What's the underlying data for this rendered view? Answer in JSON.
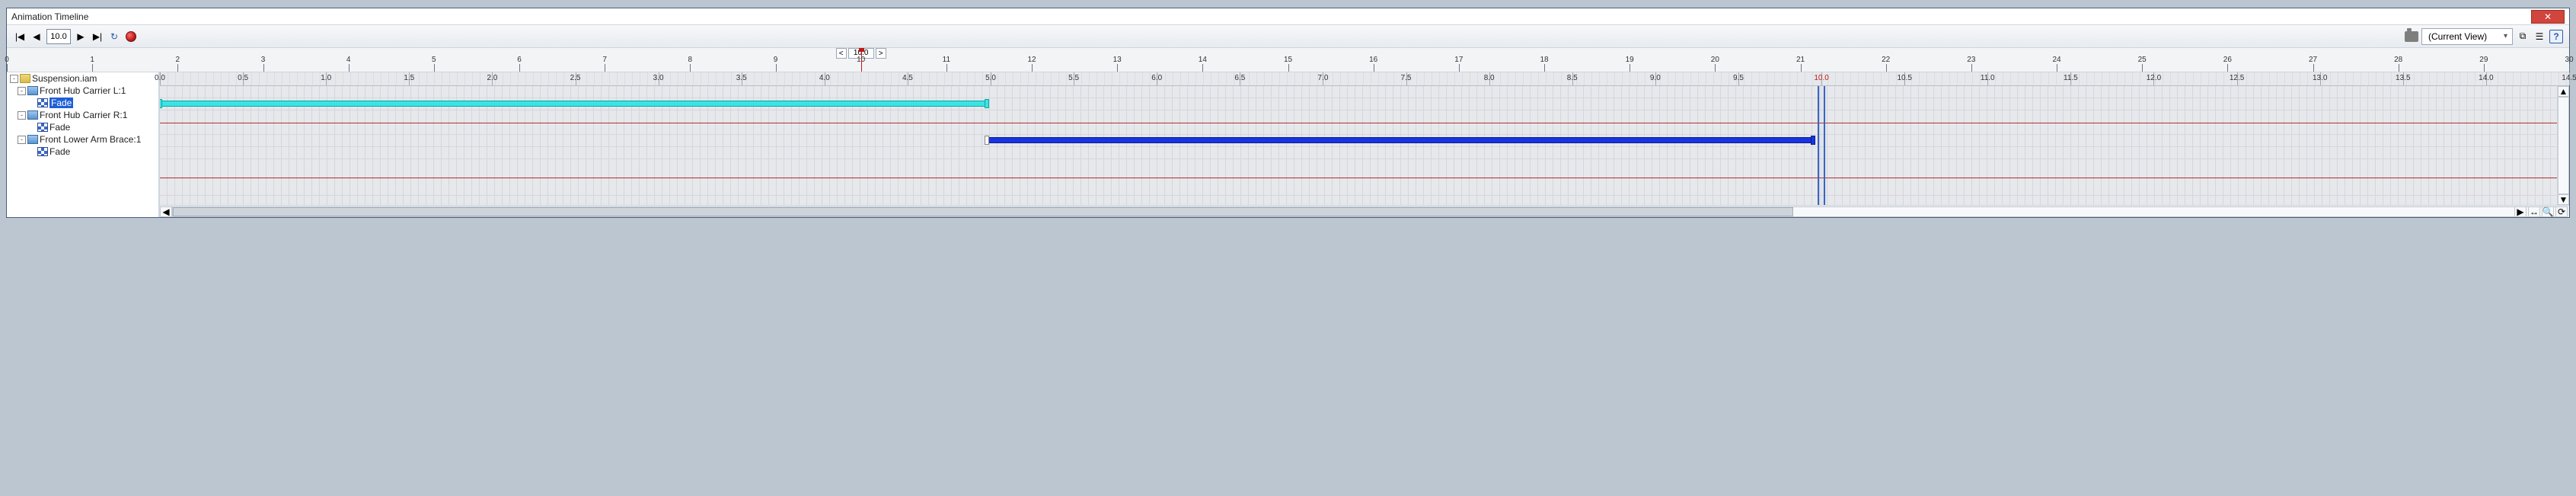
{
  "window": {
    "title": "Animation Timeline",
    "close": "✕"
  },
  "toolbar": {
    "go_start": "|◀",
    "play_rev": "◀",
    "time_field": "10.0",
    "play_fwd": "▶",
    "go_end": "▶|",
    "loop": "↻",
    "record": "●",
    "camera": "cam",
    "view_label": "(Current View)",
    "chev": "▾",
    "expand": "⧉",
    "options": "☰",
    "help": "?"
  },
  "scope": {
    "nudge_left": "<",
    "field": "10.0",
    "nudge_right": ">",
    "ticks": [
      0,
      1,
      2,
      3,
      4,
      5,
      6,
      7,
      8,
      9,
      10,
      11,
      12,
      13,
      14,
      15,
      16,
      17,
      18,
      19,
      20,
      21,
      22,
      23,
      24,
      25,
      26,
      27,
      28,
      29,
      30
    ],
    "marker_at": 10
  },
  "tree": {
    "root": "Suspension.iam",
    "items": [
      {
        "label": "Front Hub Carrier L:1",
        "child": "Fade",
        "selected": true
      },
      {
        "label": "Front Hub Carrier R:1",
        "child": "Fade",
        "selected": false
      },
      {
        "label": "Front Lower Arm Brace:1",
        "child": "Fade",
        "selected": false
      }
    ]
  },
  "timeline": {
    "ruler": [
      "0.0",
      "0.5",
      "1.0",
      "1.5",
      "2.0",
      "2.5",
      "3.0",
      "3.5",
      "4.0",
      "4.5",
      "5.0",
      "5.5",
      "6.0",
      "6.5",
      "7.0",
      "7.5",
      "8.0",
      "8.5",
      "9.0",
      "9.5",
      "10.0",
      "10.5",
      "11.0",
      "11.5",
      "12.0",
      "12.5",
      "13.0",
      "13.5",
      "14.0",
      "14.5"
    ],
    "playhead": 10.0,
    "clips": [
      {
        "row": 1,
        "color": "cyan",
        "start": 0.0,
        "end": 5.0
      },
      {
        "row": 3,
        "color": "blue",
        "start": 5.0,
        "end": 10.0
      }
    ],
    "scroll": {
      "thumb_start_pct": 0,
      "thumb_width_pct": 68
    },
    "zoom": {
      "fit": "↔",
      "mag": "🔍",
      "reset": "⟳"
    },
    "arrows": {
      "left": "◀",
      "right": "▶",
      "up": "▲",
      "down": "▼"
    }
  }
}
